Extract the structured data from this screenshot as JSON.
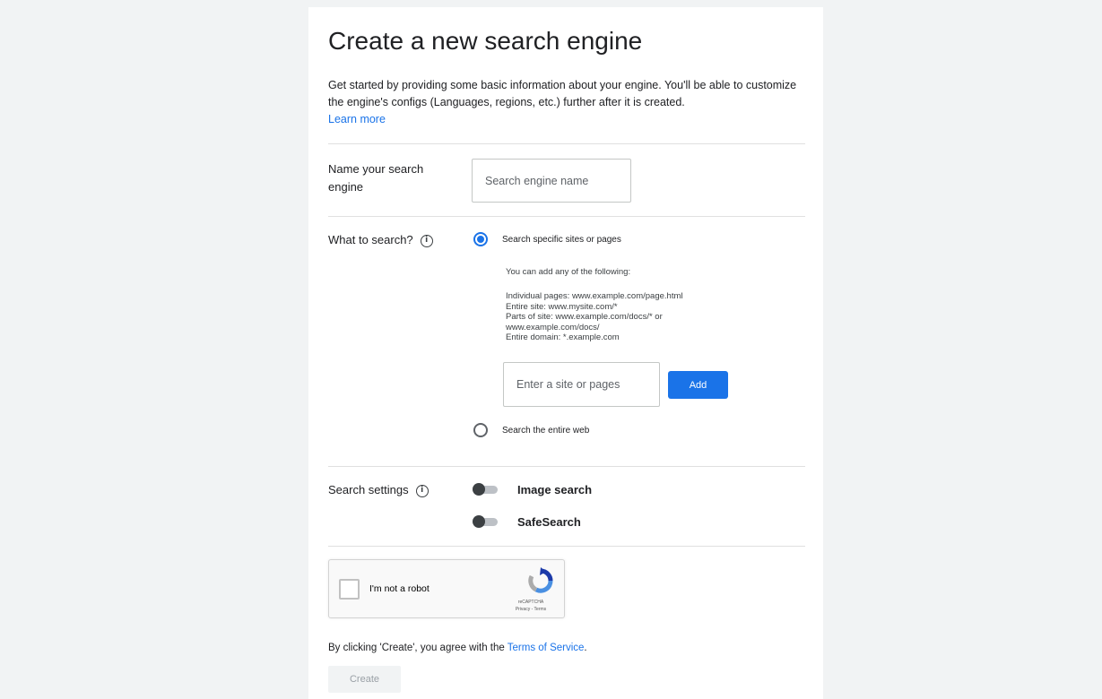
{
  "page": {
    "title": "Create a new search engine",
    "intro_text": "Get started by providing some basic information about your engine. You'll be able to customize the engine's configs (Languages, regions, etc.) further after it is created.",
    "learn_more": "Learn more"
  },
  "name_section": {
    "label": "Name your search engine",
    "placeholder": "Search engine name",
    "value": ""
  },
  "search_section": {
    "label": "What to search?",
    "info_icon": "info-icon",
    "option_specific": "Search specific sites or pages",
    "option_specific_selected": true,
    "help_intro": "You can add any of the following:",
    "help_lines": [
      "Individual pages: www.example.com/page.html",
      "Entire site: www.mysite.com/*",
      "Parts of site: www.example.com/docs/* or",
      "www.example.com/docs/",
      "Entire domain: *.example.com"
    ],
    "site_placeholder": "Enter a site or pages",
    "add_button": "Add",
    "option_entire_web": "Search the entire web",
    "option_entire_web_selected": false
  },
  "settings_section": {
    "label": "Search settings",
    "info_icon": "info-icon",
    "image_search_label": "Image search",
    "image_search_on": false,
    "safesearch_label": "SafeSearch",
    "safesearch_on": false
  },
  "captcha": {
    "label": "I'm not a robot",
    "brand": "reCAPTCHA",
    "links": "Privacy - Terms",
    "checked": false
  },
  "footer": {
    "terms_prefix": "By clicking 'Create', you agree with the ",
    "terms_link": "Terms of Service",
    "terms_suffix": ".",
    "create_button": "Create"
  },
  "colors": {
    "accent": "#1a73e8",
    "background": "#f1f3f4",
    "card": "#ffffff",
    "disabled_button": "#f1f3f4"
  }
}
